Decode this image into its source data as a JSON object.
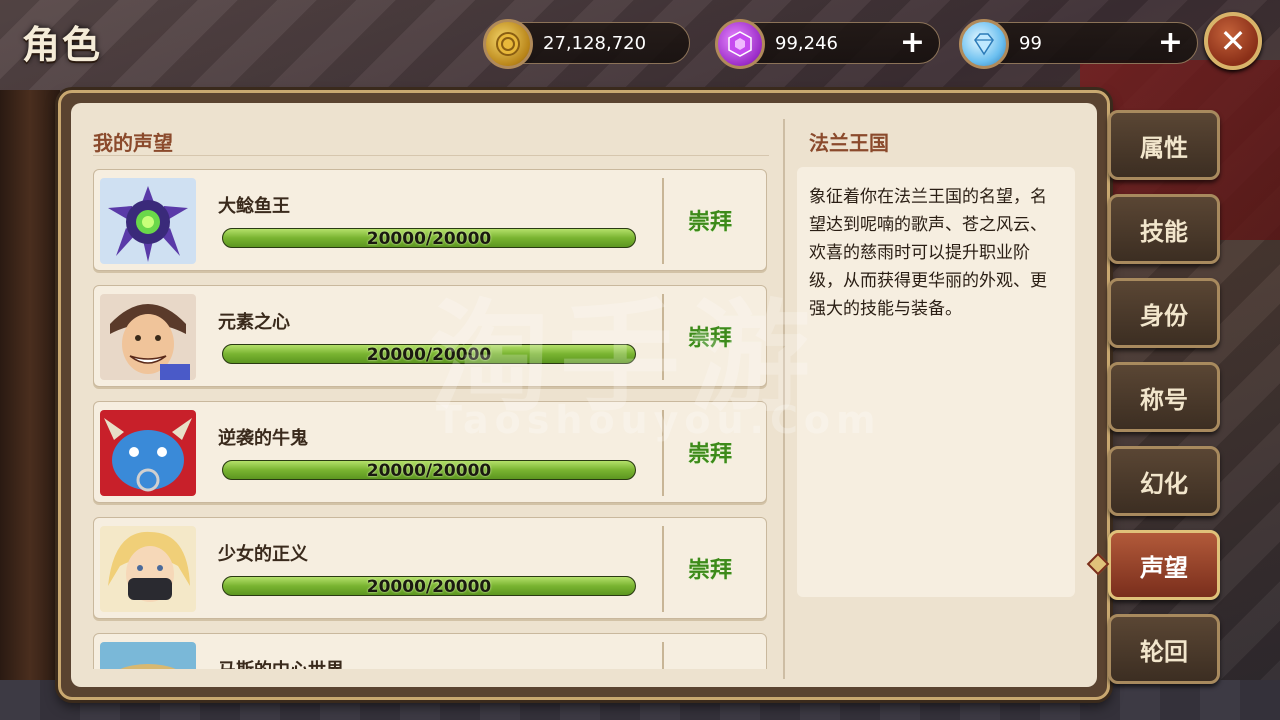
{
  "header": {
    "title": "角色",
    "currencies": [
      {
        "name": "gold-coin-icon",
        "value": "27,128,720",
        "has_plus": false
      },
      {
        "name": "purple-gem-icon",
        "value": "99,246",
        "has_plus": true
      },
      {
        "name": "diamond-icon",
        "value": "99",
        "has_plus": true
      }
    ],
    "plus_symbol": "+",
    "close_symbol": "✕"
  },
  "reputation": {
    "section_title": "我的声望",
    "items": [
      {
        "name": "大鲶鱼王",
        "progress": "20000/20000",
        "progress_fraction": 1.0,
        "rank": "崇拜",
        "portrait": "sea-urchin-creature-icon"
      },
      {
        "name": "元素之心",
        "progress": "20000/20000",
        "progress_fraction": 1.0,
        "rank": "崇拜",
        "portrait": "grinning-man-portrait"
      },
      {
        "name": "逆袭的牛鬼",
        "progress": "20000/20000",
        "progress_fraction": 1.0,
        "rank": "崇拜",
        "portrait": "blue-ox-demon-portrait"
      },
      {
        "name": "少女的正义",
        "progress": "20000/20000",
        "progress_fraction": 1.0,
        "rank": "崇拜",
        "portrait": "masked-blonde-girl-portrait"
      },
      {
        "name": "马斯的中心世界",
        "progress": "",
        "progress_fraction": null,
        "rank": "",
        "portrait": "partial-portrait"
      }
    ]
  },
  "detail": {
    "title": "法兰王国",
    "description": "象征着你在法兰王国的名望，名望达到呢喃的歌声、苍之风云、欢喜的慈雨时可以提升职业阶级，从而获得更华丽的外观、更强大的技能与装备。"
  },
  "tabs": [
    {
      "label": "属性",
      "active": false
    },
    {
      "label": "技能",
      "active": false
    },
    {
      "label": "身份",
      "active": false
    },
    {
      "label": "称号",
      "active": false
    },
    {
      "label": "幻化",
      "active": false
    },
    {
      "label": "声望",
      "active": true
    },
    {
      "label": "轮回",
      "active": false
    }
  ],
  "watermark": {
    "main": "淘手游",
    "sub": "Taoshouyou.Com"
  }
}
